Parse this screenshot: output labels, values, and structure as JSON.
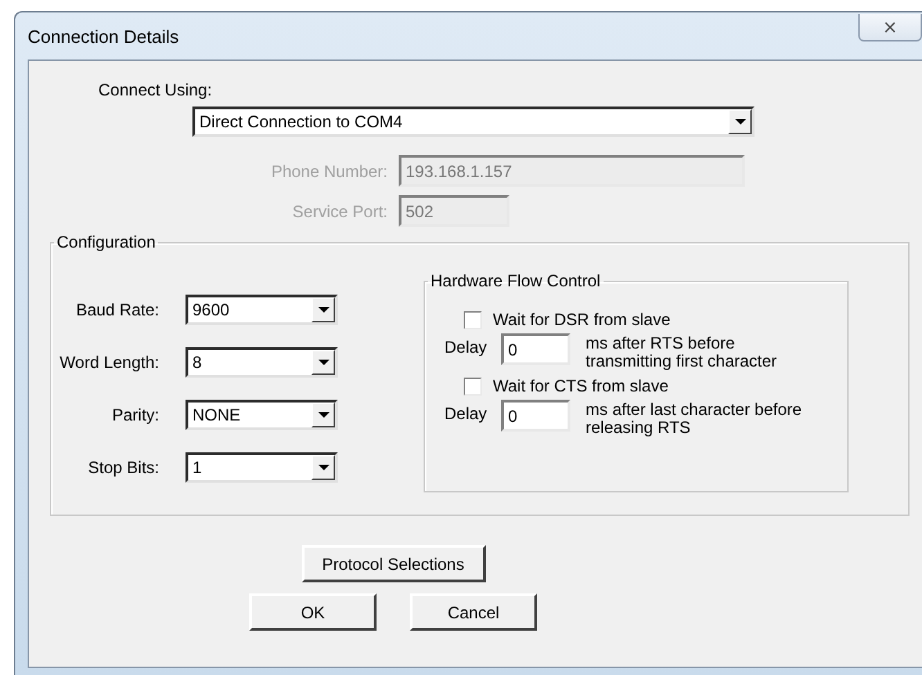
{
  "window": {
    "title": "Connection Details",
    "close": "⨯"
  },
  "connect_using": {
    "label": "Connect Using:",
    "value": "Direct Connection to COM4"
  },
  "phone_number": {
    "label": "Phone Number:",
    "value": "193.168.1.157",
    "disabled": true
  },
  "service_port": {
    "label": "Service Port:",
    "value": "502",
    "disabled": true
  },
  "configuration": {
    "title": "Configuration",
    "fields": [
      {
        "label": "Baud Rate:",
        "value": "9600"
      },
      {
        "label": "Word Length:",
        "value": "8"
      },
      {
        "label": "Parity:",
        "value": "NONE"
      },
      {
        "label": "Stop Bits:",
        "value": "1"
      }
    ]
  },
  "hardware_flow_control": {
    "title": "Hardware Flow Control",
    "items": [
      {
        "label": "Wait for DSR from slave",
        "checked": false,
        "delay_label": "Delay",
        "delay": "0",
        "note": "ms after RTS before transmitting first character"
      },
      {
        "label": "Wait for CTS from slave",
        "checked": false,
        "delay_label": "Delay",
        "delay": "0",
        "note": "ms after last character before releasing RTS"
      }
    ]
  },
  "buttons": {
    "protocol": "Protocol Selections",
    "ok": "OK",
    "cancel": "Cancel"
  }
}
